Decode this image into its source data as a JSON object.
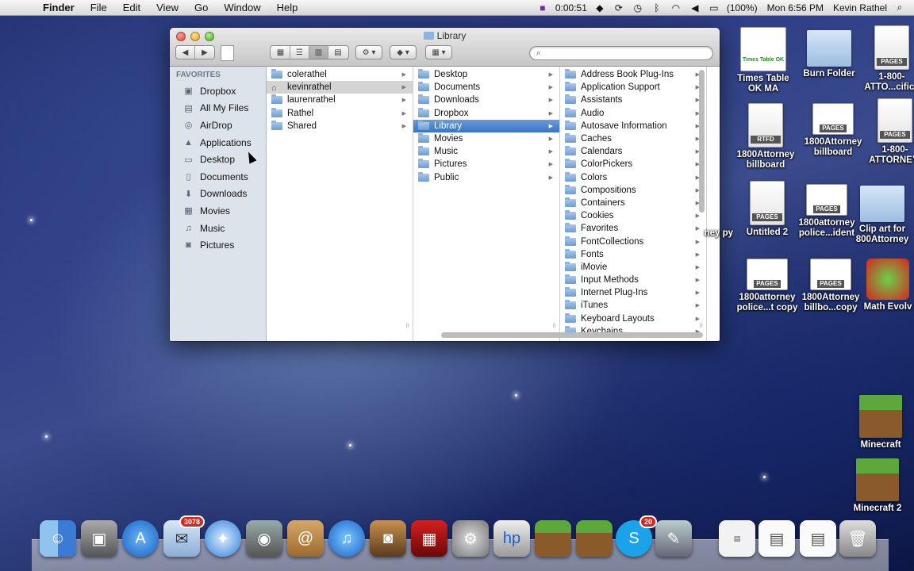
{
  "menubar": {
    "app_name": "Finder",
    "menus": [
      "File",
      "Edit",
      "View",
      "Go",
      "Window",
      "Help"
    ],
    "timer": "0:00:51",
    "battery": "(100%)",
    "clock": "Mon 6:56 PM",
    "user": "Kevin Rathel"
  },
  "window": {
    "title": "Library",
    "sidebar_header": "FAVORITES",
    "sidebar_items": [
      {
        "label": "Dropbox",
        "icon": "dropbox-icon"
      },
      {
        "label": "All My Files",
        "icon": "all-files-icon"
      },
      {
        "label": "AirDrop",
        "icon": "airdrop-icon"
      },
      {
        "label": "Applications",
        "icon": "applications-icon"
      },
      {
        "label": "Desktop",
        "icon": "desktop-icon"
      },
      {
        "label": "Documents",
        "icon": "documents-icon"
      },
      {
        "label": "Downloads",
        "icon": "downloads-icon"
      },
      {
        "label": "Movies",
        "icon": "movies-icon"
      },
      {
        "label": "Music",
        "icon": "music-icon"
      },
      {
        "label": "Pictures",
        "icon": "pictures-icon"
      }
    ],
    "column1": [
      "colerathel",
      "kevinrathel",
      "laurenrathel",
      "Rathel",
      "Shared"
    ],
    "column2": [
      "Desktop",
      "Documents",
      "Downloads",
      "Dropbox",
      "Library",
      "Movies",
      "Music",
      "Pictures",
      "Public"
    ],
    "column3": [
      "Address Book Plug-Ins",
      "Application Support",
      "Assistants",
      "Audio",
      "Autosave Information",
      "Caches",
      "Calendars",
      "ColorPickers",
      "Colors",
      "Compositions",
      "Containers",
      "Cookies",
      "Favorites",
      "FontCollections",
      "Fonts",
      "iMovie",
      "Input Methods",
      "Internet Plug-Ins",
      "iTunes",
      "Keyboard Layouts",
      "Keychains"
    ]
  },
  "desktop_icons": {
    "times_table": "Times Table OK MA",
    "burn_folder": "Burn Folder",
    "attorney_cifics": "1-800-ATTO...cifics",
    "billboard_1": "1800Attorney billboard",
    "billboard_2": "1800Attorney billboard",
    "attorney_2": "1-800-ATTORNEY-",
    "untitled": "Untitled 2",
    "police_ident": "1800attorney police...ident",
    "clipart": "Clip art for 800Attorney",
    "police_copy": "1800attorney police...t copy",
    "billbo_copy": "1800Attorney billbo...copy",
    "math": "Math Evolv",
    "minecraft": "Minecraft",
    "minecraft2": "Minecraft 2",
    "partial_label": "ney py",
    "pages_label": "PAGES",
    "rtfd_label": "RTFD",
    "times_thumb_label": "Times Table OK"
  },
  "dock": {
    "badge_mail": "3078",
    "badge_skype": "20"
  }
}
